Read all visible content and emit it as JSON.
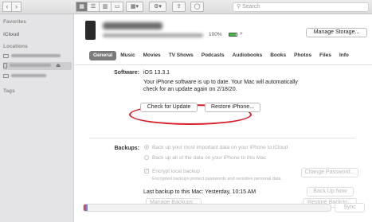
{
  "toolbar": {
    "back": "‹",
    "forward": "›",
    "search_placeholder": "Search"
  },
  "sidebar": {
    "favorites_label": "Favorites",
    "icloud_label": "iCloud",
    "locations_label": "Locations",
    "tags_label": "Tags"
  },
  "device": {
    "battery_pct": "100%",
    "manage_storage": "Manage Storage..."
  },
  "tabs": [
    "General",
    "Music",
    "Movies",
    "TV Shows",
    "Podcasts",
    "Audiobooks",
    "Books",
    "Photos",
    "Files",
    "Info"
  ],
  "software": {
    "label": "Software:",
    "version": "iOS 13.3.1",
    "message": "Your iPhone software is up to date. Your Mac will automatically check for an update again on 2/18/20.",
    "check_update": "Check for Update",
    "restore": "Restore iPhone..."
  },
  "backups": {
    "label": "Backups:",
    "opt_icloud": "Back up your most important data on your iPhone to iCloud",
    "opt_mac": "Back up all of the data on your iPhone to this Mac",
    "encrypt": "Encrypt local backup",
    "encrypt_note": "Encrypted backups protect passwords and sensitive personal data.",
    "change_password": "Change Password...",
    "last_backup": "Last backup to this Mac:  Yesterday, 10:15 AM",
    "back_up_now": "Back Up Now",
    "manage_backups": "Manage Backups...",
    "restore_backup": "Restore Backup..."
  },
  "sync_label": "Sync",
  "colors": {
    "highlight_oval": "#d81d27",
    "battery_fill": "#3bbd3e"
  }
}
